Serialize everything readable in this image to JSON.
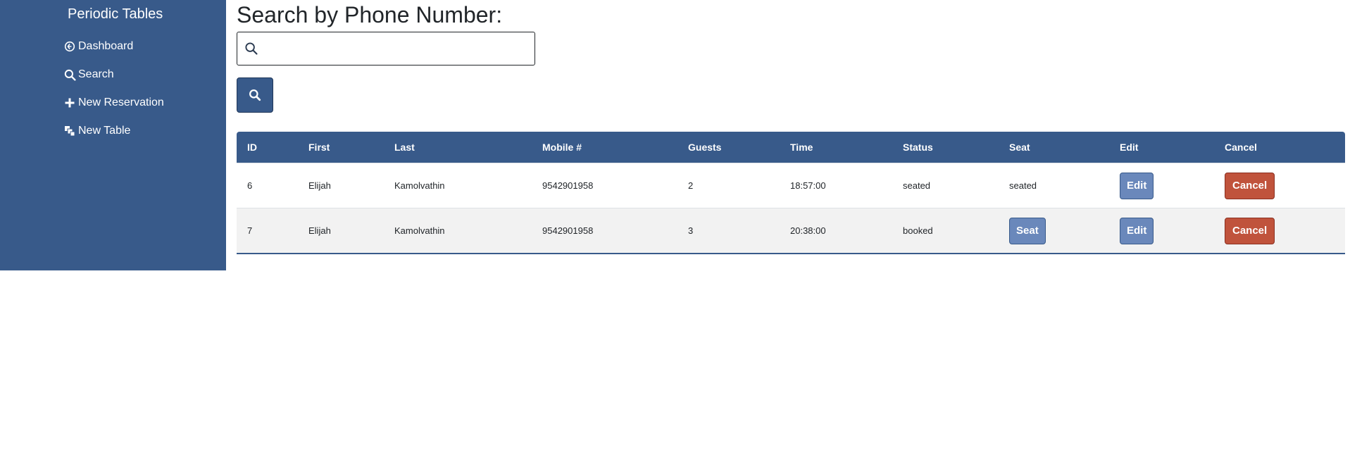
{
  "sidebar": {
    "brand": "Periodic Tables",
    "items": [
      {
        "label": "Dashboard",
        "icon": "dashboard-icon"
      },
      {
        "label": "Search",
        "icon": "search-icon"
      },
      {
        "label": "New Reservation",
        "icon": "plus-icon"
      },
      {
        "label": "New Table",
        "icon": "layers-icon"
      }
    ]
  },
  "main": {
    "title": "Search by Phone Number:",
    "search": {
      "value": "",
      "placeholder": "",
      "button_icon": "search-icon"
    }
  },
  "table": {
    "headers": [
      "ID",
      "First",
      "Last",
      "Mobile #",
      "Guests",
      "Time",
      "Status",
      "Seat",
      "Edit",
      "Cancel"
    ],
    "rows": [
      {
        "id": "6",
        "first": "Elijah",
        "last": "Kamolvathin",
        "mobile": "9542901958",
        "guests": "2",
        "time": "18:57:00",
        "status": "seated",
        "seat": "seated",
        "edit": "Edit",
        "cancel": "Cancel"
      },
      {
        "id": "7",
        "first": "Elijah",
        "last": "Kamolvathin",
        "mobile": "9542901958",
        "guests": "3",
        "time": "20:38:00",
        "status": "booked",
        "seat": "Seat",
        "edit": "Edit",
        "cancel": "Cancel"
      }
    ]
  },
  "colors": {
    "primary": "#385a8a",
    "button": "#6a88bb",
    "danger": "#c0533c"
  }
}
